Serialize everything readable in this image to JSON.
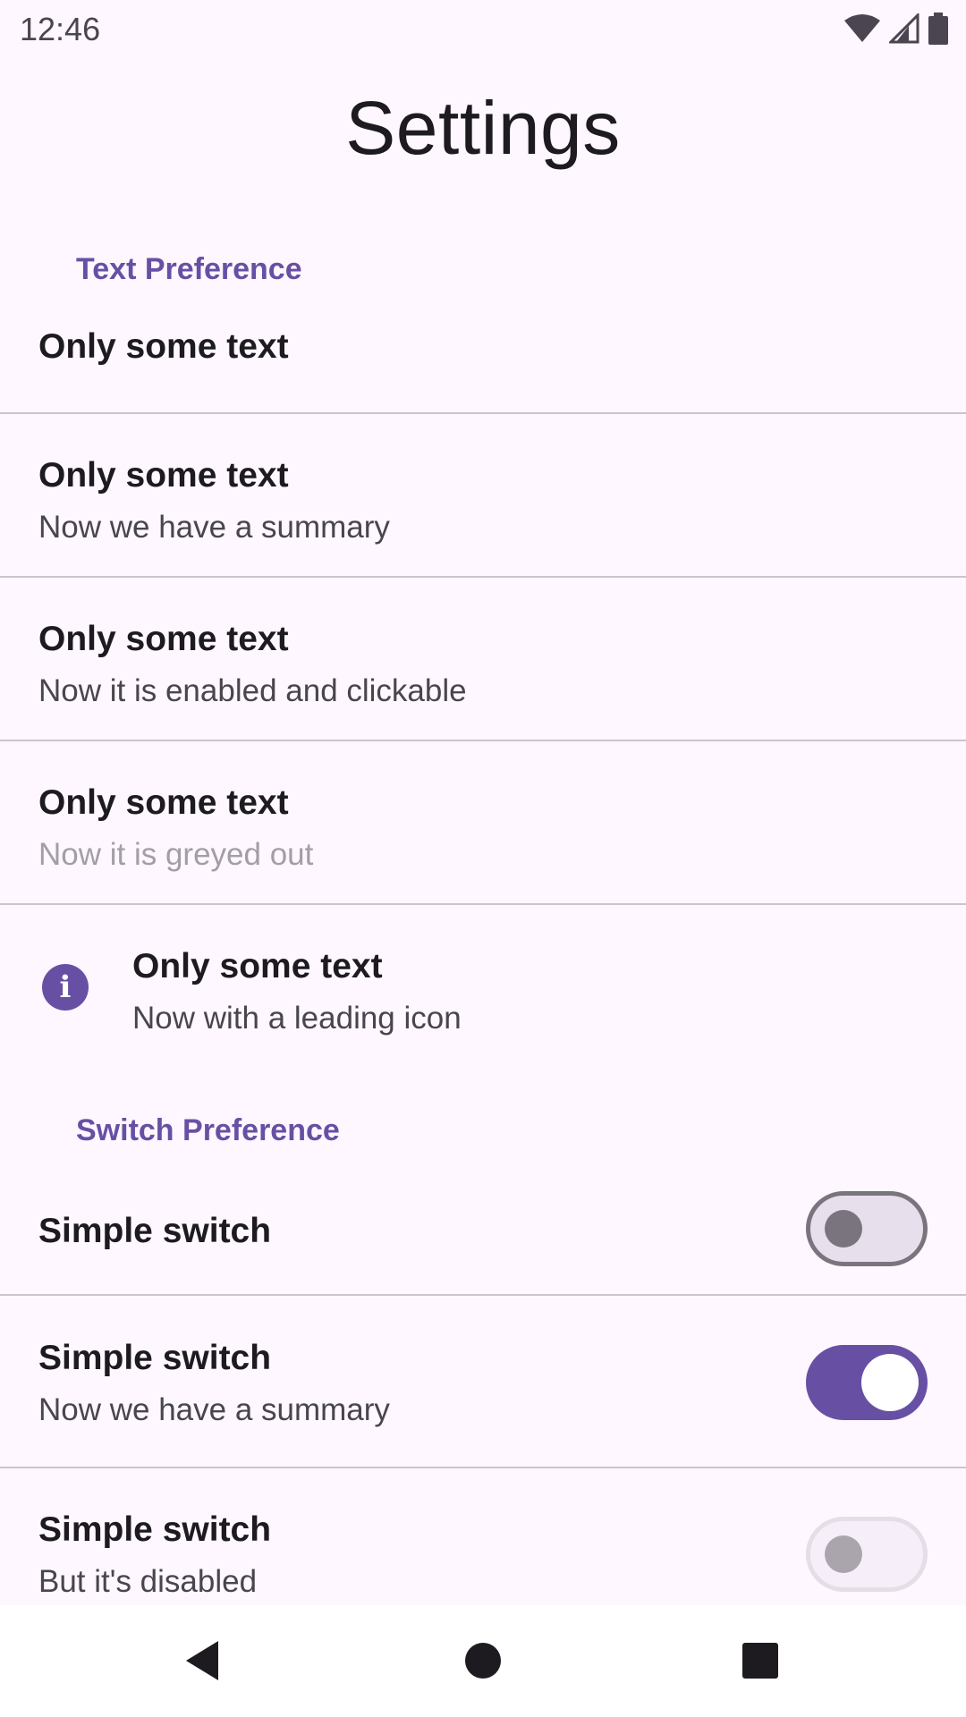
{
  "status_bar": {
    "time": "12:46",
    "icons": [
      "wifi-icon",
      "signal-icon",
      "battery-icon"
    ]
  },
  "title": "Settings",
  "text_category": "Text Preference",
  "text_items": [
    {
      "title": "Only some text",
      "summary": ""
    },
    {
      "title": "Only some text",
      "summary": "Now we have a summary"
    },
    {
      "title": "Only some text",
      "summary": "Now it is enabled and clickable"
    },
    {
      "title": "Only some text",
      "summary": "Now it is greyed out",
      "disabled": true
    },
    {
      "title": "Only some text",
      "summary": "Now with a leading icon",
      "icon": "info-icon"
    }
  ],
  "switch_category": "Switch Preference",
  "switch_items": [
    {
      "title": "Simple switch",
      "summary": "",
      "checked": false,
      "enabled": true
    },
    {
      "title": "Simple switch",
      "summary": "Now we have a summary",
      "checked": true,
      "enabled": true
    },
    {
      "title": "Simple switch",
      "summary": "But it's disabled",
      "checked": false,
      "enabled": false
    }
  ],
  "nav_bar": {
    "buttons": [
      "back-icon",
      "home-icon",
      "recents-icon"
    ]
  },
  "colors": {
    "accent": "#6750a4",
    "background": "#fef7ff",
    "divider": "#cac4d0"
  }
}
